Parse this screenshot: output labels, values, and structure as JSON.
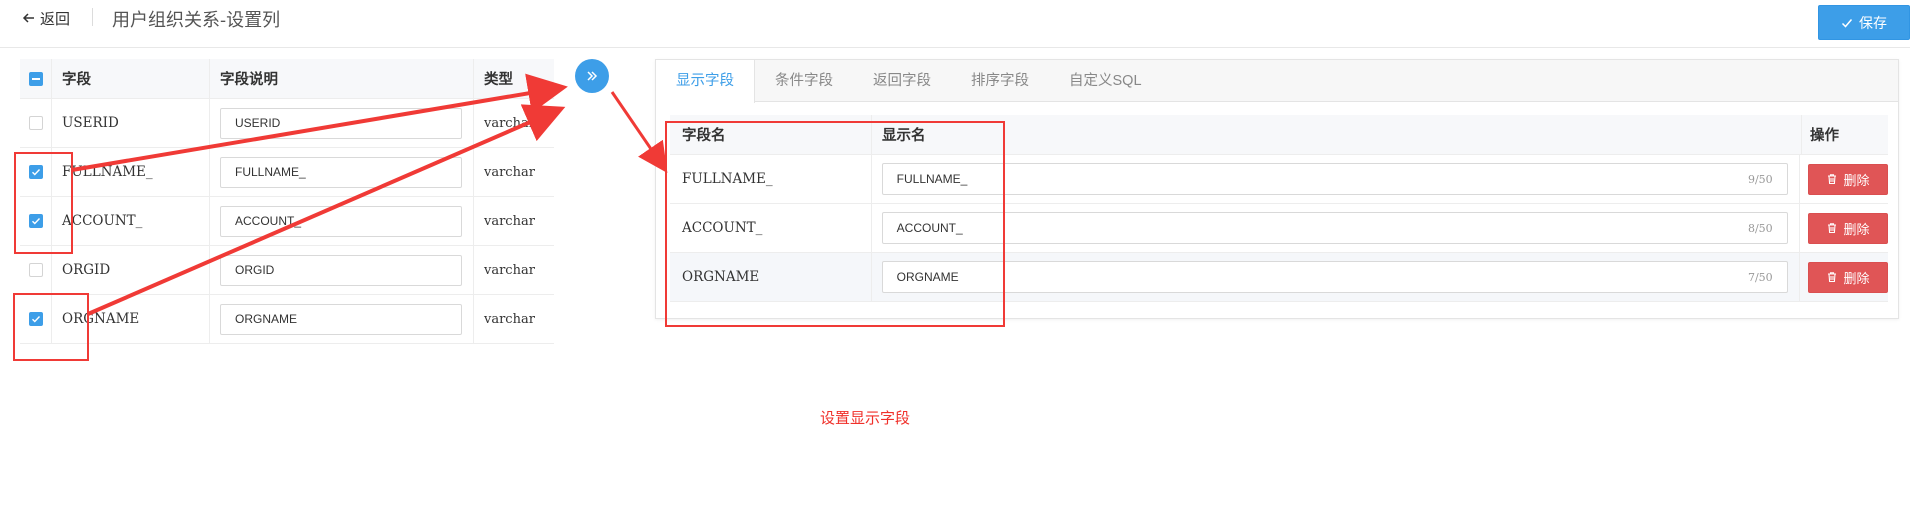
{
  "header": {
    "back_label": "返回",
    "title": "用户组织关系-设置列",
    "save_label": "保存"
  },
  "left_table": {
    "columns": [
      "字段",
      "字段说明",
      "类型"
    ],
    "rows": [
      {
        "field": "USERID",
        "desc": "USERID",
        "type": "varchar",
        "checked": false
      },
      {
        "field": "FULLNAME_",
        "desc": "FULLNAME_",
        "type": "varchar",
        "checked": true
      },
      {
        "field": "ACCOUNT_",
        "desc": "ACCOUNT_",
        "type": "varchar",
        "checked": true
      },
      {
        "field": "ORGID",
        "desc": "ORGID",
        "type": "varchar",
        "checked": false
      },
      {
        "field": "ORGNAME",
        "desc": "ORGNAME",
        "type": "varchar",
        "checked": true
      }
    ]
  },
  "tabs": [
    {
      "label": "显示字段",
      "active": true
    },
    {
      "label": "条件字段",
      "active": false
    },
    {
      "label": "返回字段",
      "active": false
    },
    {
      "label": "排序字段",
      "active": false
    },
    {
      "label": "自定义SQL",
      "active": false
    }
  ],
  "right_table": {
    "columns": [
      "字段名",
      "显示名",
      "操作"
    ],
    "delete_label": "删除",
    "rows": [
      {
        "field": "FULLNAME_",
        "display": "FULLNAME_",
        "count": "9/50"
      },
      {
        "field": "ACCOUNT_",
        "display": "ACCOUNT_",
        "count": "8/50"
      },
      {
        "field": "ORGNAME",
        "display": "ORGNAME",
        "count": "7/50"
      }
    ]
  },
  "caption": "设置显示字段",
  "colors": {
    "primary": "#3d9ee8",
    "danger": "#e05556",
    "annotation": "#f03a36"
  },
  "icons": {
    "back": "arrow-left-icon",
    "save": "check-icon",
    "transfer": "double-chevron-right-icon",
    "delete": "trash-icon"
  }
}
